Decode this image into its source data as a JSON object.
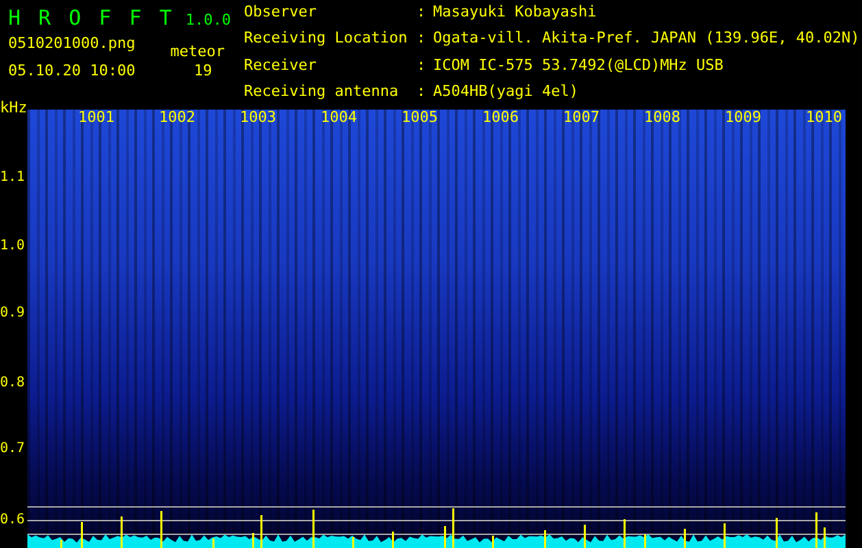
{
  "app": {
    "title": "H R O F F T",
    "version": "1.0.0"
  },
  "file": {
    "name": "0510201000.png",
    "datetime": "05.10.20 10:00"
  },
  "meteor": {
    "label": "meteor",
    "count": "19"
  },
  "info": [
    {
      "label": "Observer",
      "separator": ":",
      "value": "Masayuki Kobayashi"
    },
    {
      "label": "Receiving Location",
      "separator": ":",
      "value": "Ogata-vill. Akita-Pref. JAPAN (139.96E, 40.02N)"
    },
    {
      "label": "Receiver",
      "separator": ":",
      "value": "ICOM IC-575 53.7492(@LCD)MHz USB"
    },
    {
      "label": "Receiving antenna",
      "separator": ":",
      "value": "A504HB(yagi 4el)"
    }
  ],
  "spectrogram": {
    "unit": "kHz",
    "frequency_labels": [
      "1.1",
      "1.0",
      "0.9",
      "0.8",
      "0.7",
      "0.6"
    ],
    "time_labels": [
      "1001",
      "1002",
      "1003",
      "1004",
      "1005",
      "1006",
      "1007",
      "1008",
      "1009",
      "1010"
    ]
  }
}
